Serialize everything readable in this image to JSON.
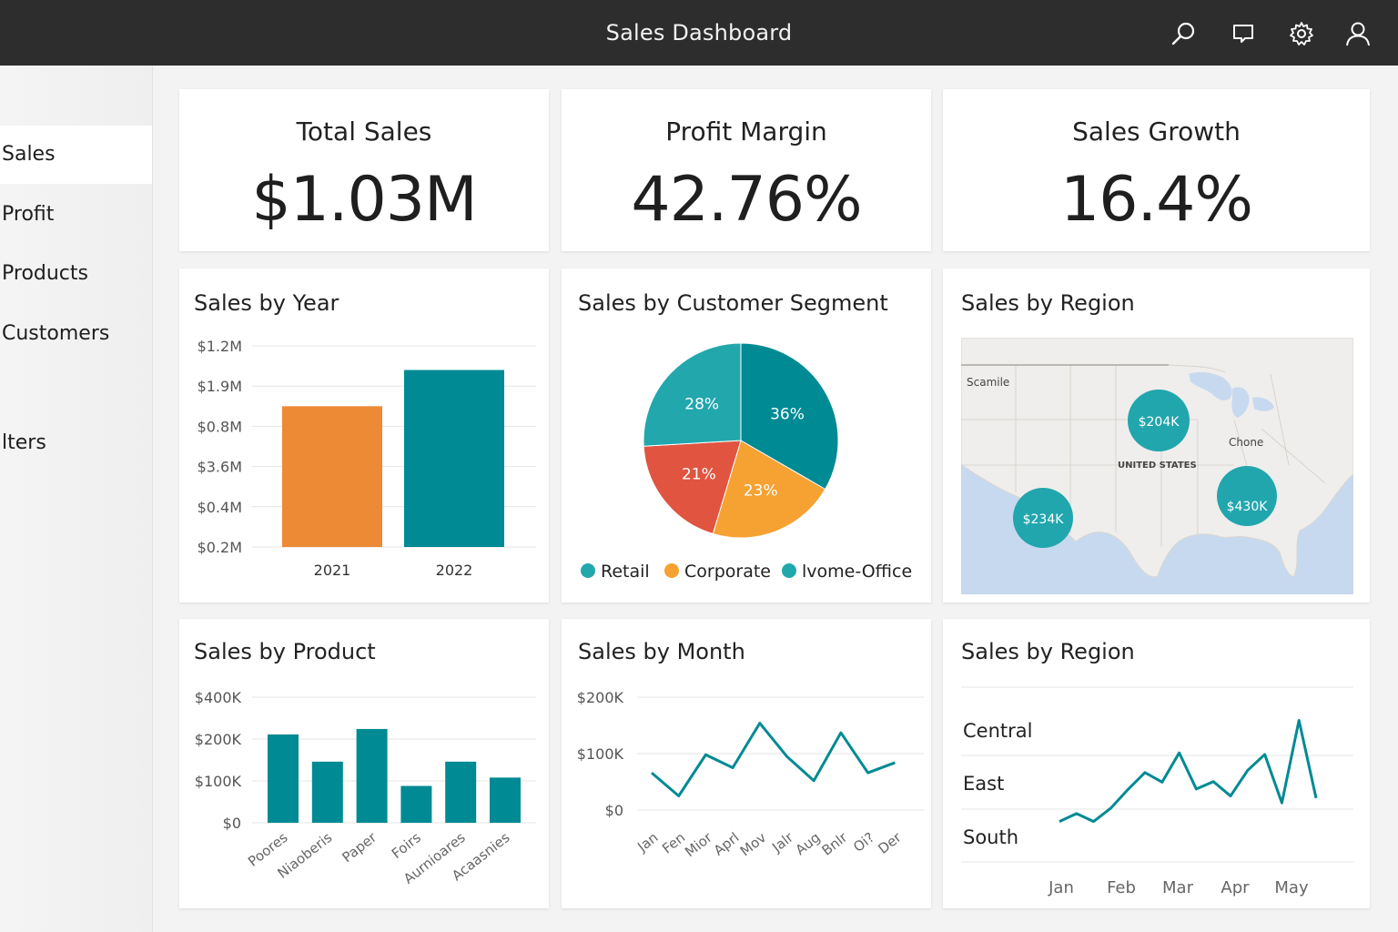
{
  "app": {
    "title": "Sales Dashboard",
    "icons": [
      "search-icon",
      "chat-icon",
      "gear-icon",
      "user-icon"
    ]
  },
  "sidebar": {
    "items": [
      {
        "label": "Sales",
        "active": true
      },
      {
        "label": "Profit",
        "active": false
      },
      {
        "label": "Products",
        "active": false
      },
      {
        "label": "Customers",
        "active": false
      },
      {
        "label": "lters",
        "active": false
      }
    ]
  },
  "kpis": [
    {
      "label": "Total Sales",
      "value": "$1.03M"
    },
    {
      "label": "Profit Margin",
      "value": "42.76%"
    },
    {
      "label": "Sales Growth",
      "value": "16.4%"
    }
  ],
  "colors": {
    "teal": "#008a94",
    "teal_light": "#22a7ad",
    "orange": "#ed8a35",
    "orange_light": "#f5a233",
    "red": "#e05440",
    "topbar": "#2d2d2d"
  },
  "sales_by_year": {
    "title": "Sales by Year",
    "chart_data": {
      "type": "bar",
      "categories": [
        "2021",
        "2022"
      ],
      "tick_labels": [
        "$1.2M",
        "$1.9M",
        "$0.8M",
        "$3.6M",
        "$0.4M",
        "$0.2M"
      ],
      "values": [
        0.7,
        0.88
      ],
      "colors": [
        "#ed8a35",
        "#008a94"
      ]
    }
  },
  "sales_by_segment": {
    "title": "Sales by Customer Segment",
    "chart_data": {
      "type": "pie",
      "slices": [
        {
          "label": "36%",
          "value": 36,
          "color": "#008a94"
        },
        {
          "label": "23%",
          "value": 23,
          "color": "#f5a233"
        },
        {
          "label": "21%",
          "value": 21,
          "color": "#e05440"
        },
        {
          "label": "28%",
          "value": 28,
          "color": "#22a7ad"
        }
      ],
      "legend": [
        {
          "label": "Retail",
          "color": "#22a7ad"
        },
        {
          "label": "Corporate",
          "color": "#f5a233"
        },
        {
          "label": "lvome-Office",
          "color": "#22a7ad"
        }
      ]
    }
  },
  "sales_by_region_map": {
    "title": "Sales by Region",
    "map_labels": [
      "Scamile",
      "Chone",
      "UNITED STATES"
    ],
    "bubbles": [
      "$204K",
      "$234K",
      "$430K"
    ]
  },
  "sales_by_product": {
    "title": "Sales by Product",
    "chart_data": {
      "type": "bar",
      "categories": [
        "Poores",
        "Niaoberis",
        "Paper",
        "Foirs",
        "Aurnioares",
        "Acaasnies"
      ],
      "values": [
        222,
        146,
        248,
        88,
        146,
        108
      ],
      "y_ticks": [
        {
          "label": "$400K",
          "value": 400
        },
        {
          "label": "$200K",
          "value": 200
        },
        {
          "label": "$100K",
          "value": 100
        },
        {
          "label": "$0",
          "value": 0
        }
      ]
    }
  },
  "sales_by_month": {
    "title": "Sales by Month",
    "chart_data": {
      "type": "line",
      "categories": [
        "Jan",
        "Fen",
        "Mior",
        "Aprl",
        "Mov",
        "Jalr",
        "Aug",
        "Bnlr",
        "Oi?",
        "Der"
      ],
      "values": [
        66,
        25,
        98,
        75,
        154,
        95,
        52,
        137,
        66,
        84
      ],
      "y_ticks": [
        {
          "label": "$200K",
          "value": 200
        },
        {
          "label": "$100K",
          "value": 100
        },
        {
          "label": "$0",
          "value": 0
        }
      ]
    }
  },
  "sales_by_region_line": {
    "title": "Sales by Region",
    "chart_data": {
      "type": "line",
      "row_labels": [
        "Central",
        "East",
        "South"
      ],
      "x_labels": [
        "Jan",
        "Feb",
        "Mar",
        "Apr",
        "May"
      ],
      "values": [
        2.72,
        2.57,
        2.72,
        2.47,
        2.12,
        1.8,
        1.98,
        1.43,
        2.11,
        1.97,
        2.24,
        1.76,
        1.46,
        2.37,
        0.82,
        2.28
      ]
    }
  }
}
